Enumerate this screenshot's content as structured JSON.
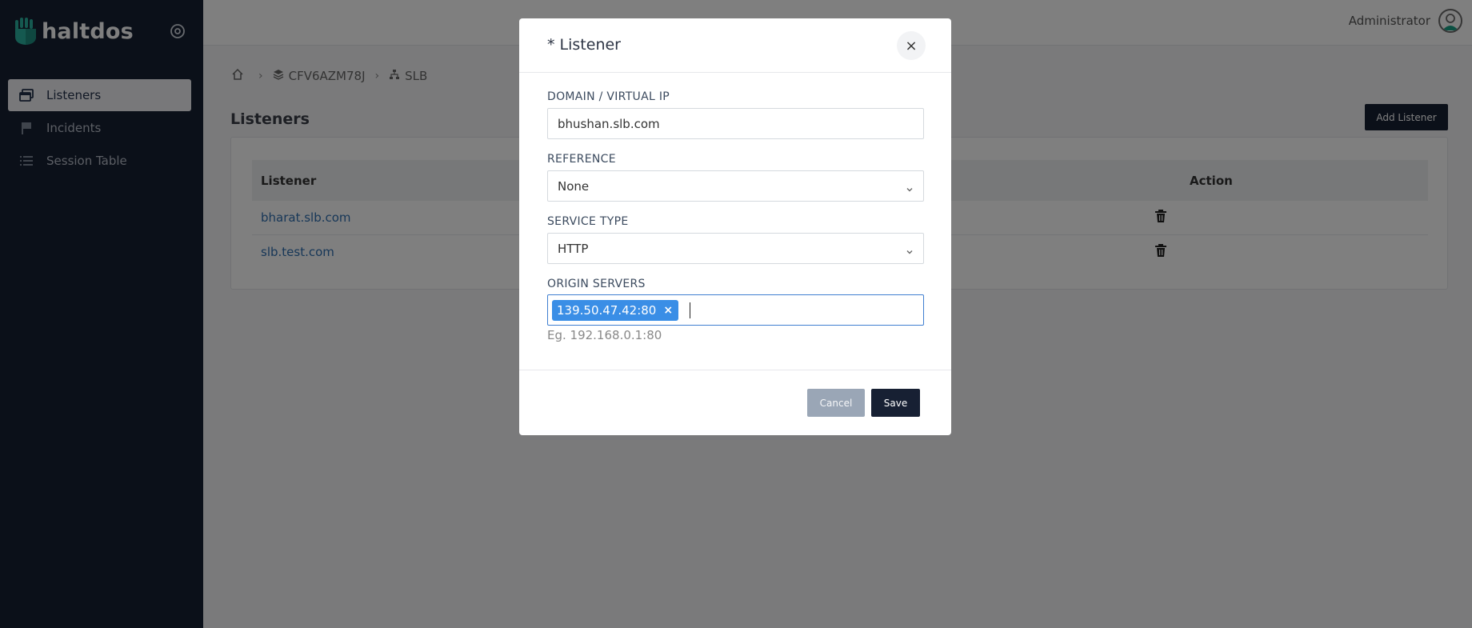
{
  "app": {
    "logo_text": "haltdos"
  },
  "sidebar": {
    "items": [
      {
        "label": "Listeners",
        "icon": "listeners-icon",
        "active": true
      },
      {
        "label": "Incidents",
        "icon": "flag-icon",
        "active": false
      },
      {
        "label": "Session Table",
        "icon": "list-icon",
        "active": false
      }
    ]
  },
  "header": {
    "user_name": "Administrator"
  },
  "breadcrumb": {
    "items": [
      {
        "label": "",
        "icon": "home-icon"
      },
      {
        "label": "CFV6AZM78J",
        "icon": "layers-icon"
      },
      {
        "label": "SLB",
        "icon": "sitemap-icon"
      }
    ],
    "separator": "›"
  },
  "page": {
    "title": "Listeners",
    "add_button": "Add Listener"
  },
  "table": {
    "columns": [
      "Listener",
      "Action"
    ],
    "rows": [
      {
        "listener": "bharat.slb.com"
      },
      {
        "listener": "slb.test.com"
      }
    ]
  },
  "modal": {
    "title": "* Listener",
    "close": "×",
    "fields": {
      "domain": {
        "label": "DOMAIN / VIRTUAL IP",
        "value": "bhushan.slb.com"
      },
      "reference": {
        "label": "REFERENCE",
        "value": "None"
      },
      "service_type": {
        "label": "SERVICE TYPE",
        "value": "HTTP"
      },
      "origin_servers": {
        "label": "ORIGIN SERVERS",
        "tags": [
          "139.50.47.42:80"
        ],
        "tag_remove": "×",
        "hint": "Eg. 192.168.0.1:80"
      }
    },
    "cancel_label": "Cancel",
    "save_label": "Save"
  },
  "colors": {
    "sidebar_bg": "#172033",
    "primary_button": "#172033",
    "link": "#2f6fb0",
    "tag_bg": "#3a8ee6",
    "focus_border": "#3f7fd1"
  }
}
